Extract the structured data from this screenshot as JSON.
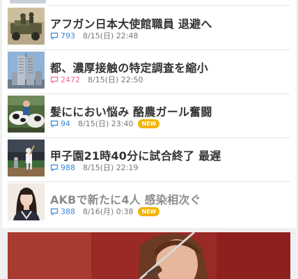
{
  "news": [
    {
      "title": "アフガン日本大使館職員 退避へ",
      "comments": "793",
      "date": "8/15(日) 22:48",
      "new_badge": "",
      "read": false,
      "hot": false,
      "thumb": "soldiers-vehicle"
    },
    {
      "title": "都、濃厚接触の特定調査を縮小",
      "comments": "2472",
      "date": "8/15(日) 22:50",
      "new_badge": "",
      "read": false,
      "hot": true,
      "thumb": "tower-building"
    },
    {
      "title": "髪ににおい悩み 酪農ガール奮闘",
      "comments": "94",
      "date": "8/15(日) 23:40",
      "new_badge": "NEW",
      "read": false,
      "hot": false,
      "thumb": "dairy-cows"
    },
    {
      "title": "甲子園21時40分に試合終了 最遅",
      "comments": "988",
      "date": "8/15(日) 22:19",
      "new_badge": "",
      "read": false,
      "hot": false,
      "thumb": "baseball-night"
    },
    {
      "title": "AKBで新たに4人 感染相次ぐ",
      "comments": "388",
      "date": "8/16(月) 0:38",
      "new_badge": "NEW",
      "read": true,
      "hot": false,
      "thumb": "idol-portrait"
    }
  ],
  "colors": {
    "comment_blue": "#3a86d6",
    "comment_hot": "#ec6d8f",
    "new_badge": "#f4b400"
  }
}
